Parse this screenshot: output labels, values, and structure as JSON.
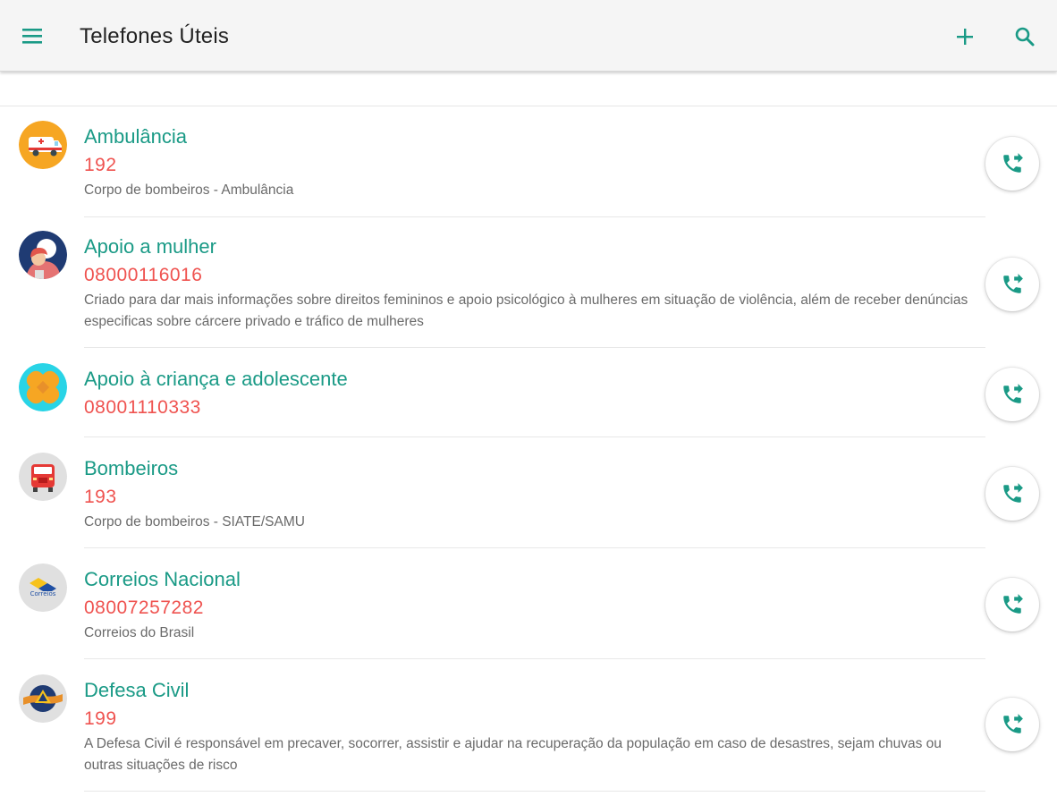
{
  "app": {
    "title": "Telefones Úteis"
  },
  "toolbar": {
    "menu_icon": "menu-icon",
    "add_icon": "plus-icon",
    "search_icon": "search-icon"
  },
  "colors": {
    "accent": "#1a9a86",
    "phone": "#ef5350",
    "appbar": "#f5f5f5"
  },
  "contacts": [
    {
      "name": "Ambulância",
      "phone": "192",
      "description": "Corpo de bombeiros - Ambulância",
      "icon": "ambulance-icon"
    },
    {
      "name": "Apoio a mulher",
      "phone": "08000116016",
      "description": "Criado para dar mais informações sobre direitos femininos e apoio psicológico à mulheres em situação de violência, além de receber denúncias especificas sobre cárcere privado e tráfico de mulheres",
      "icon": "woman-icon"
    },
    {
      "name": "Apoio à criança e adolescente",
      "phone": "08001110333",
      "description": "",
      "icon": "bandage-icon"
    },
    {
      "name": "Bombeiros",
      "phone": "193",
      "description": "Corpo de bombeiros - SIATE/SAMU",
      "icon": "fire-truck-icon"
    },
    {
      "name": "Correios Nacional",
      "phone": "08007257282",
      "description": "Correios do Brasil",
      "icon": "correios-logo-icon"
    },
    {
      "name": "Defesa Civil",
      "phone": "199",
      "description": "A Defesa Civil é responsável em precaver, socorrer, assistir e ajudar na recuperação da população em caso de desastres, sejam chuvas ou outras situações de risco",
      "icon": "civil-defense-icon"
    }
  ]
}
